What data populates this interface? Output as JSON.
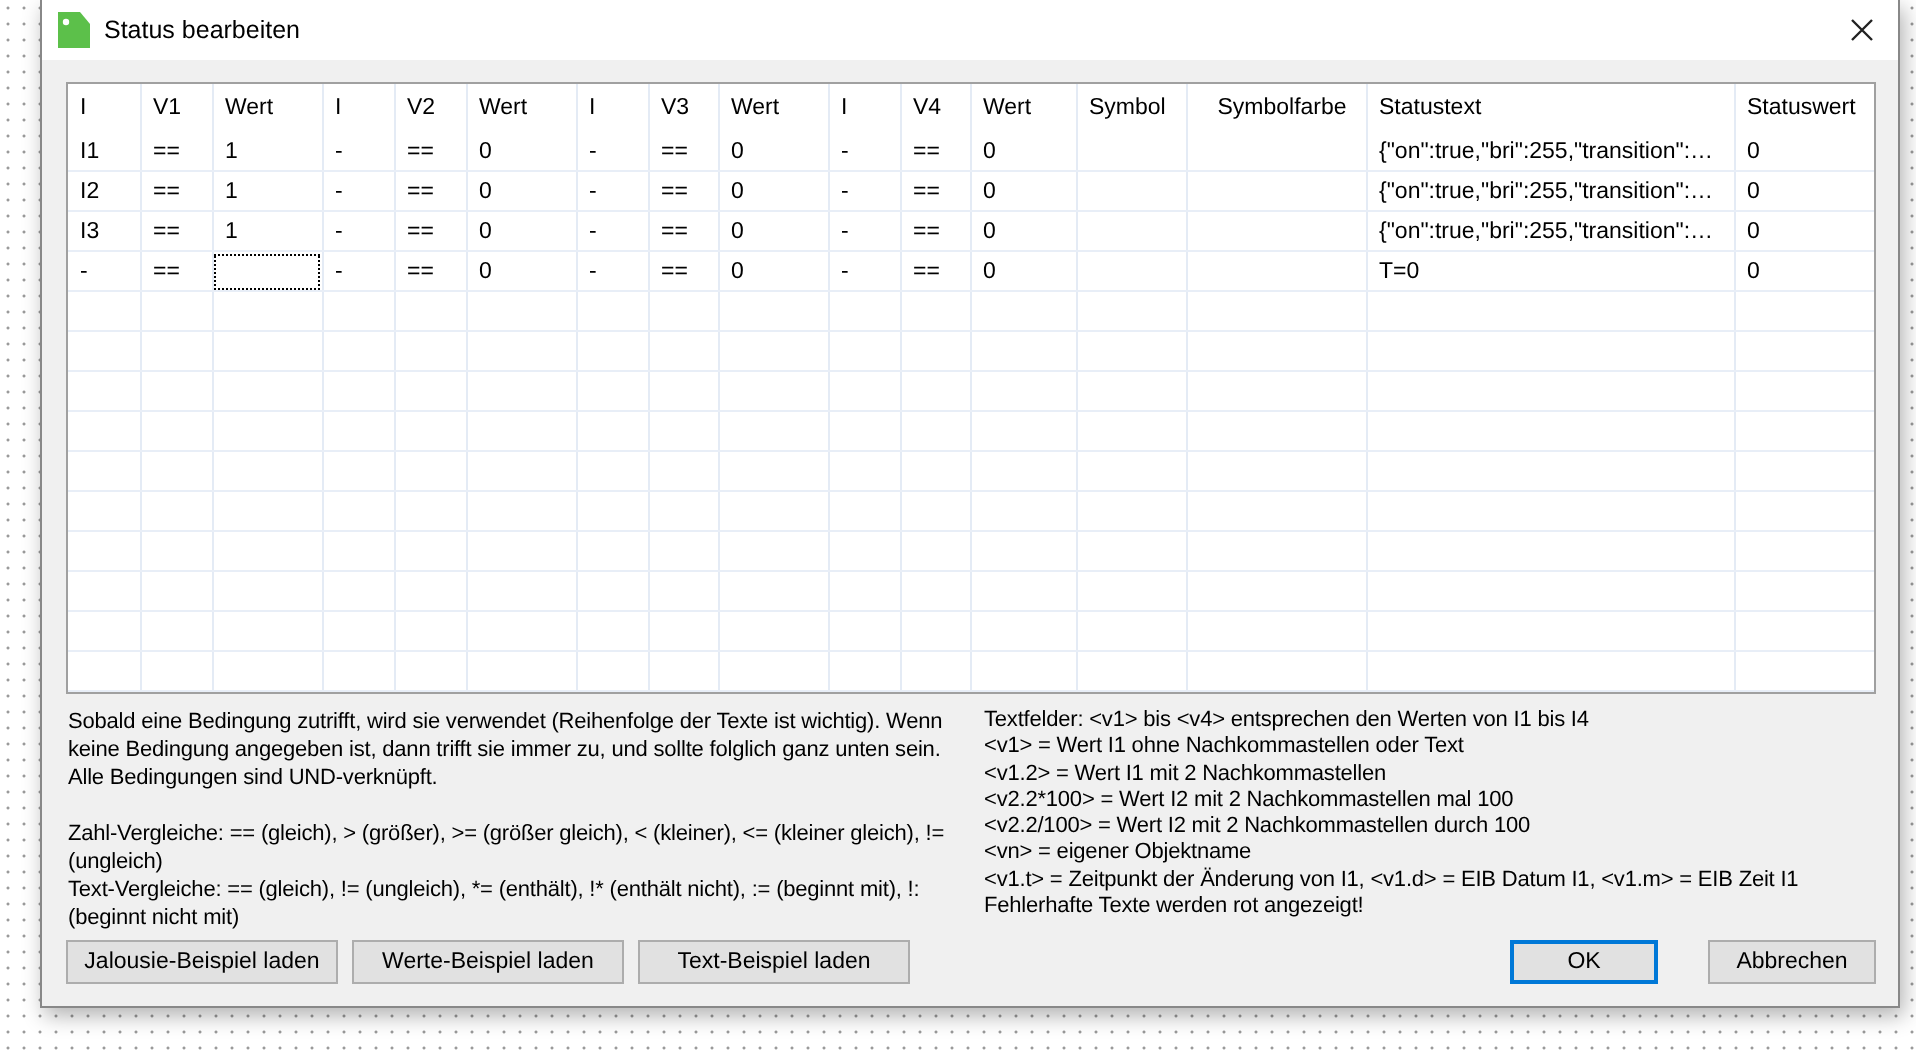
{
  "window": {
    "title": "Status bearbeiten"
  },
  "table": {
    "columns": [
      "I",
      "V1",
      "Wert",
      "I",
      "V2",
      "Wert",
      "I",
      "V3",
      "Wert",
      "I",
      "V4",
      "Wert",
      "Symbol",
      "Symbolfarbe",
      "Statustext",
      "Statuswert"
    ],
    "rows": [
      {
        "cells": [
          {
            "text": "I1",
            "focused": false
          },
          {
            "text": "==",
            "focused": false
          },
          {
            "text": "1",
            "focused": false
          },
          {
            "text": "-",
            "focused": false
          },
          {
            "text": "==",
            "focused": false
          },
          {
            "text": "0",
            "focused": false
          },
          {
            "text": "-",
            "focused": false
          },
          {
            "text": "==",
            "focused": false
          },
          {
            "text": "0",
            "focused": false
          },
          {
            "text": "-",
            "focused": false
          },
          {
            "text": "==",
            "focused": false
          },
          {
            "text": "0",
            "focused": false
          },
          {
            "focused": false
          },
          {
            "focused": false
          },
          {
            "text": "{\"on\":true,\"bri\":255,\"transition\":…",
            "focused": false
          },
          {
            "text": "0",
            "focused": false
          }
        ]
      },
      {
        "cells": [
          {
            "text": "I2",
            "focused": false
          },
          {
            "text": "==",
            "focused": false
          },
          {
            "text": "1",
            "focused": false
          },
          {
            "text": "-",
            "focused": false
          },
          {
            "text": "==",
            "focused": false
          },
          {
            "text": "0",
            "focused": false
          },
          {
            "text": "-",
            "focused": false
          },
          {
            "text": "==",
            "focused": false
          },
          {
            "text": "0",
            "focused": false
          },
          {
            "text": "-",
            "focused": false
          },
          {
            "text": "==",
            "focused": false
          },
          {
            "text": "0",
            "focused": false
          },
          {
            "focused": false
          },
          {
            "focused": false
          },
          {
            "text": "{\"on\":true,\"bri\":255,\"transition\":…",
            "focused": false
          },
          {
            "text": "0",
            "focused": false
          }
        ]
      },
      {
        "cells": [
          {
            "text": "I3",
            "focused": false
          },
          {
            "text": "==",
            "focused": false
          },
          {
            "text": "1",
            "focused": false
          },
          {
            "text": "-",
            "focused": false
          },
          {
            "text": "==",
            "focused": false
          },
          {
            "text": "0",
            "focused": false
          },
          {
            "text": "-",
            "focused": false
          },
          {
            "text": "==",
            "focused": false
          },
          {
            "text": "0",
            "focused": false
          },
          {
            "text": "-",
            "focused": false
          },
          {
            "text": "==",
            "focused": false
          },
          {
            "text": "0",
            "focused": false
          },
          {
            "focused": false
          },
          {
            "focused": false
          },
          {
            "text": "{\"on\":true,\"bri\":255,\"transition\":…",
            "focused": false
          },
          {
            "text": "0",
            "focused": false
          }
        ]
      },
      {
        "cells": [
          {
            "text": "-",
            "focused": false
          },
          {
            "text": "==",
            "focused": false
          },
          {
            "focused": true
          },
          {
            "text": "-",
            "focused": false
          },
          {
            "text": "==",
            "focused": false
          },
          {
            "text": "0",
            "focused": false
          },
          {
            "text": "-",
            "focused": false
          },
          {
            "text": "==",
            "focused": false
          },
          {
            "text": "0",
            "focused": false
          },
          {
            "text": "-",
            "focused": false
          },
          {
            "text": "==",
            "focused": false
          },
          {
            "text": "0",
            "focused": false
          },
          {
            "focused": false
          },
          {
            "focused": false
          },
          {
            "text": "T=0",
            "focused": false
          },
          {
            "text": "0",
            "focused": false
          }
        ]
      }
    ]
  },
  "help_left": [
    "Sobald eine Bedingung zutrifft, wird sie verwendet (Reihenfolge der Texte ist wichtig). Wenn keine Bedingung angegeben ist, dann trifft sie immer zu, und sollte folglich ganz unten sein. Alle Bedingungen sind UND-verknüpft.",
    "Zahl-Vergleiche: == (gleich), > (größer), >= (größer gleich), < (kleiner), <= (kleiner gleich), != (ungleich)",
    "Text-Vergleiche: == (gleich), != (ungleich), *= (enthält), !* (enthält nicht), := (beginnt mit), !: (beginnt nicht mit)"
  ],
  "help_right": [
    "Textfelder: <v1> bis <v4> entsprechen den Werten von I1 bis I4",
    "<v1> = Wert I1 ohne Nachkommastellen oder Text",
    "<v1.2> = Wert I1 mit 2 Nachkommastellen",
    "<v2.2*100> = Wert I2 mit 2 Nachkommastellen mal 100",
    "<v2.2/100> = Wert I2 mit 2 Nachkommastellen durch 100",
    "<vn> = eigener Objektname",
    "<v1.t> = Zeitpunkt der Änderung von I1, <v1.d> = EIB Datum I1, <v1.m> = EIB Zeit I1",
    "Fehlerhafte Texte werden rot angezeigt!"
  ],
  "example_buttons": [
    "Jalousie-Beispiel laden",
    "Werte-Beispiel laden",
    "Text-Beispiel laden"
  ],
  "dialog_buttons": [
    {
      "label": "OK",
      "default": true
    },
    {
      "label": "Abbrechen",
      "default": false
    }
  ]
}
